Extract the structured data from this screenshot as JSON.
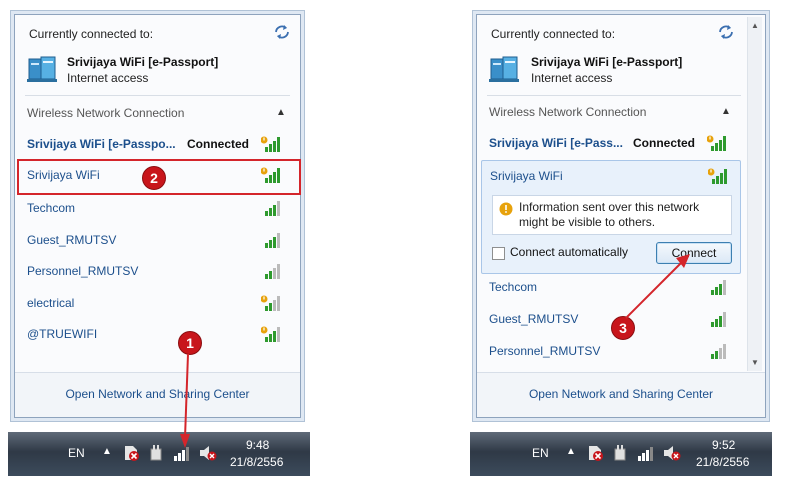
{
  "left": {
    "header": "Currently connected to:",
    "current_network": {
      "name": "Srivijaya WiFi [e-Passport]",
      "status": "Internet access"
    },
    "section_title": "Wireless Network Connection",
    "networks": [
      {
        "name": "Srivijaya WiFi [e-Passpo...",
        "status": "Connected",
        "secured": false,
        "bold": true
      },
      {
        "name": "Srivijaya WiFi",
        "status": "",
        "secured": false,
        "bold": false
      },
      {
        "name": "Techcom",
        "status": "",
        "secured": true,
        "bold": false
      },
      {
        "name": "Guest_RMUTSV",
        "status": "",
        "secured": true,
        "bold": false
      },
      {
        "name": "Personnel_RMUTSV",
        "status": "",
        "secured": true,
        "bold": false
      },
      {
        "name": "electrical",
        "status": "",
        "secured": false,
        "bold": false
      },
      {
        "name": "@TRUEWIFI",
        "status": "",
        "secured": false,
        "bold": false
      }
    ],
    "footer_link": "Open Network and Sharing Center",
    "taskbar": {
      "lang": "EN",
      "time": "9:48",
      "date": "21/8/2556"
    },
    "callouts": {
      "one": "1",
      "two": "2"
    }
  },
  "right": {
    "header": "Currently connected to:",
    "current_network": {
      "name": "Srivijaya WiFi [e-Passport]",
      "status": "Internet access"
    },
    "section_title": "Wireless Network Connection",
    "connected": {
      "name": "Srivijaya WiFi [e-Pass...",
      "status": "Connected"
    },
    "selected": {
      "name": "Srivijaya WiFi",
      "warning": "Information sent over this network might be visible to others.",
      "auto_label": "Connect automatically",
      "auto_checked": false,
      "connect_label": "Connect"
    },
    "networks": [
      {
        "name": "Techcom"
      },
      {
        "name": "Guest_RMUTSV"
      },
      {
        "name": "Personnel_RMUTSV"
      }
    ],
    "footer_link": "Open Network and Sharing Center",
    "taskbar": {
      "lang": "EN",
      "time": "9:52",
      "date": "21/8/2556"
    },
    "callouts": {
      "three": "3"
    }
  },
  "colors": {
    "link": "#1c4f8c",
    "callout": "#c8151b",
    "signal": "#2e9a2e"
  }
}
